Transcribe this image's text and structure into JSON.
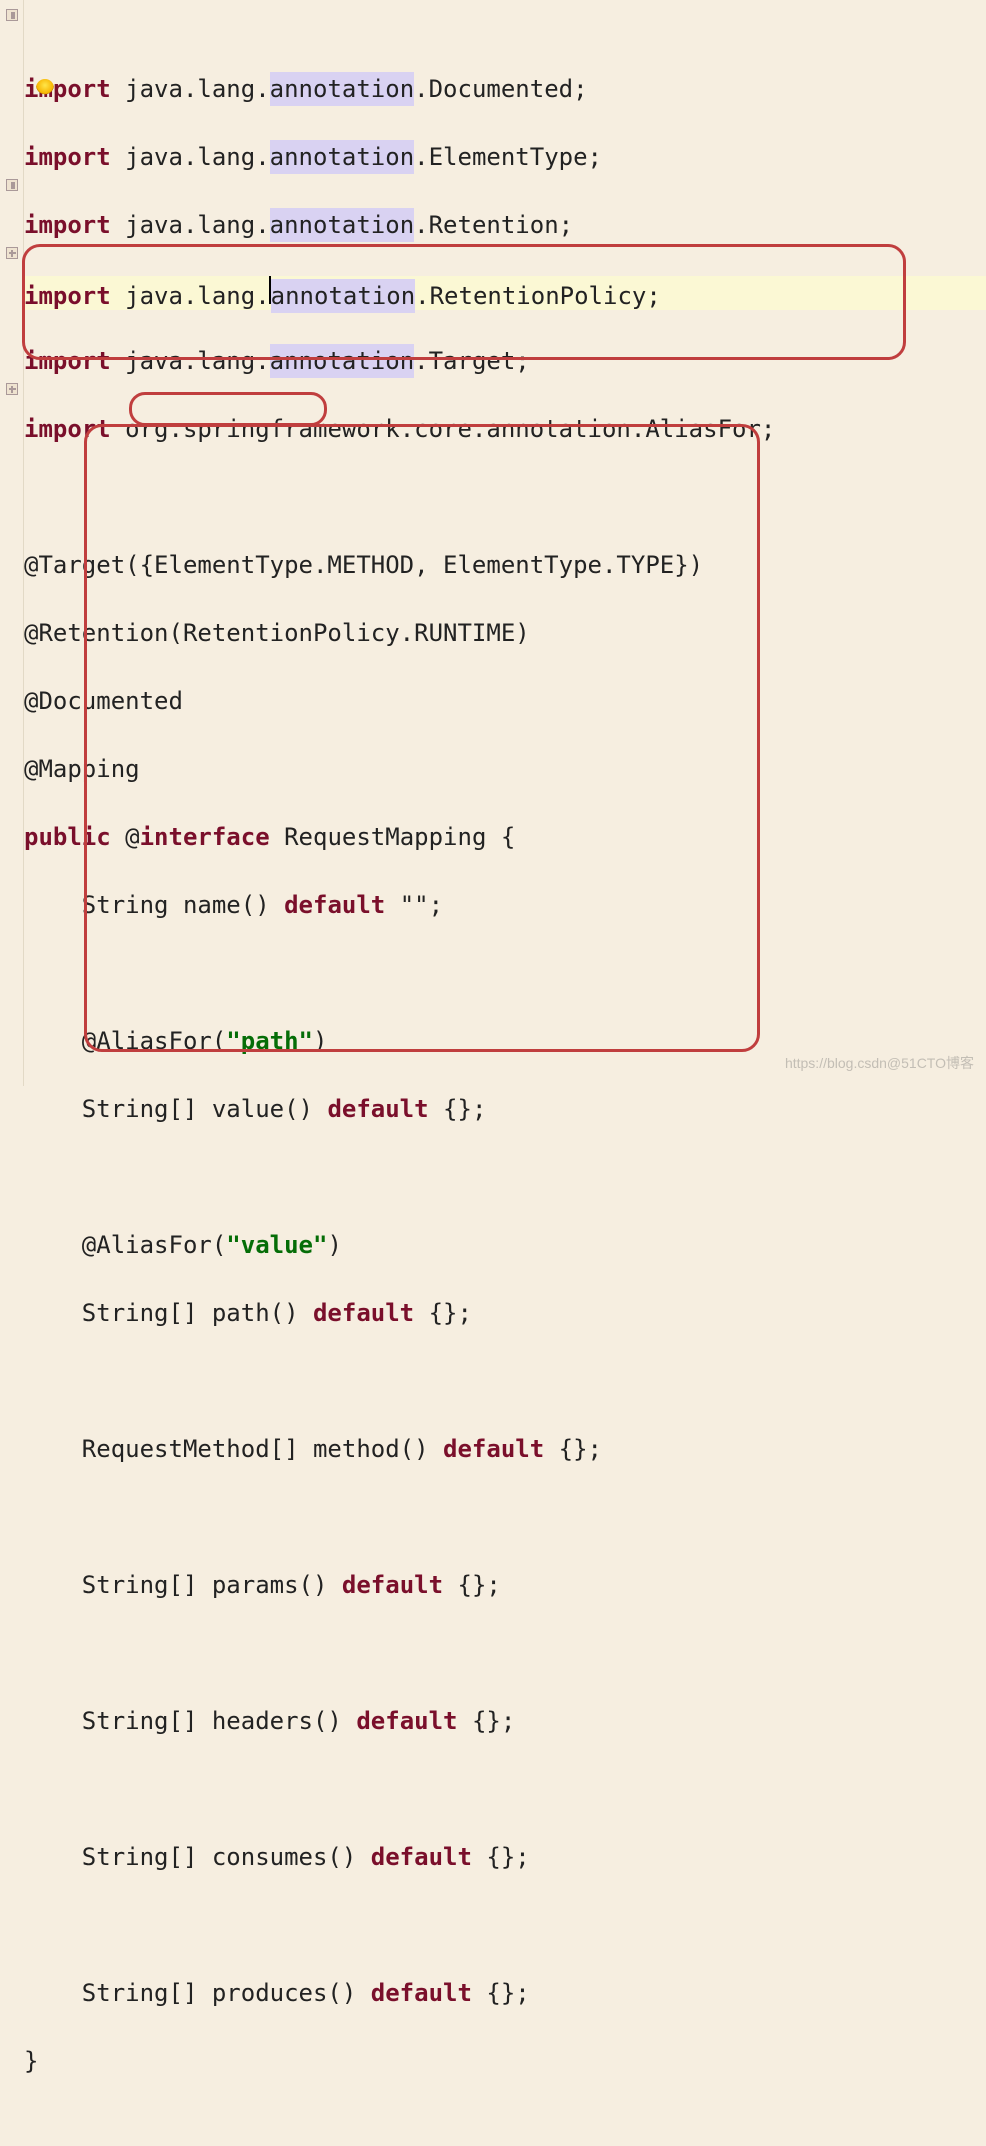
{
  "imports": [
    {
      "kw": "import",
      "p1": " java.lang.",
      "pkg": "annotation",
      "p2": ".Documented;"
    },
    {
      "kw": "import",
      "p1": " java.lang.",
      "pkg": "annotation",
      "p2": ".ElementType;"
    },
    {
      "kw": "import",
      "p1": " java.lang.",
      "pkg": "annotation",
      "p2": ".Retention;"
    },
    {
      "kw": "import",
      "p1": " java.lang.",
      "pkg": "annotation",
      "p2": ".RetentionPolicy;"
    },
    {
      "kw": "import",
      "p1": " java.lang.",
      "pkg": "annotation",
      "p2": ".Target;"
    },
    {
      "kw": "import",
      "p1": " org.springframework.core.annotation.AliasFor;",
      "pkg": "",
      "p2": ""
    }
  ],
  "ann": {
    "target": "@Target({ElementType.METHOD, ElementType.TYPE})",
    "retention": "@Retention(RetentionPolicy.RUNTIME)",
    "documented": "@Documented",
    "mapping": "@Mapping"
  },
  "decl": {
    "pub": "public",
    "at": " @",
    "intf": "interface",
    "rest": " RequestMapping {"
  },
  "body": {
    "l1a": "    String name() ",
    "l1k": "default",
    "l1b": " \"\";",
    "l3a": "    @AliasFor(",
    "l3s": "\"path\"",
    "l3b": ")",
    "l4a": "    String[] value() ",
    "l4k": "default",
    "l4b": " {};",
    "l6a": "    @AliasFor(",
    "l6s": "\"value\"",
    "l6b": ")",
    "l7a": "    String[] path() ",
    "l7k": "default",
    "l7b": " {};",
    "l9a": "    RequestMethod[] method() ",
    "l9k": "default",
    "l9b": " {};",
    "l11a": "    String[] params() ",
    "l11k": "default",
    "l11b": " {};",
    "l13a": "    String[] headers() ",
    "l13k": "default",
    "l13b": " {};",
    "l15a": "    String[] consumes() ",
    "l15k": "default",
    "l15b": " {};",
    "l17a": "    String[] produces() ",
    "l17k": "default",
    "l17b": " {};"
  },
  "close": "}",
  "watermark": "https://blog.csdn@51CTO博客"
}
